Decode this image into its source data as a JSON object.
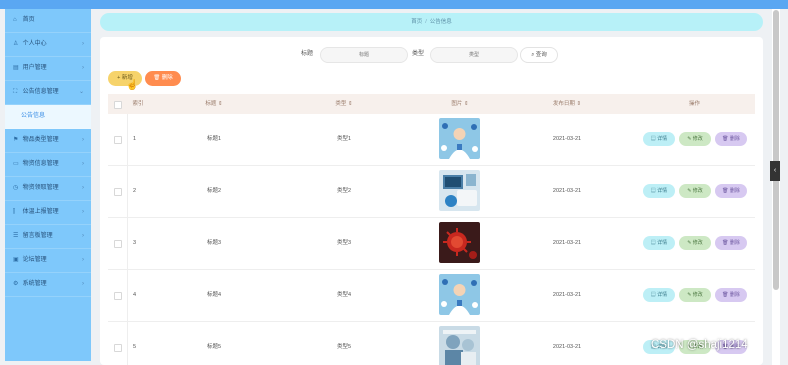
{
  "sidebar": {
    "items": [
      {
        "label": "首页",
        "icon": "home-icon",
        "glyph": "⌂",
        "arrow": ""
      },
      {
        "label": "个人中心",
        "icon": "user-icon",
        "glyph": "♙",
        "arrow": "›"
      },
      {
        "label": "用户管理",
        "icon": "users-icon",
        "glyph": "▤",
        "arrow": "›"
      },
      {
        "label": "公告信息管理",
        "icon": "notice-icon",
        "glyph": "⛶",
        "arrow": "⌄"
      },
      {
        "label": "公告信息",
        "icon": "",
        "glyph": "",
        "arrow": "",
        "sub": true
      },
      {
        "label": "物品类型管理",
        "icon": "category-icon",
        "glyph": "⚑",
        "arrow": "›"
      },
      {
        "label": "物资信息管理",
        "icon": "goods-icon",
        "glyph": "▭",
        "arrow": "›"
      },
      {
        "label": "物资领取管理",
        "icon": "receive-icon",
        "glyph": "◷",
        "arrow": "›"
      },
      {
        "label": "体温上报管理",
        "icon": "temperature-icon",
        "glyph": "⫿",
        "arrow": "›"
      },
      {
        "label": "留言板管理",
        "icon": "message-icon",
        "glyph": "☰",
        "arrow": "›"
      },
      {
        "label": "论坛管理",
        "icon": "forum-icon",
        "glyph": "▣",
        "arrow": "›"
      },
      {
        "label": "系统管理",
        "icon": "settings-icon",
        "glyph": "⚙",
        "arrow": "›"
      }
    ]
  },
  "breadcrumb": {
    "home": "首页",
    "separator": "/",
    "current": "公告信息"
  },
  "search": {
    "title_label": "标题",
    "title_placeholder": "标题",
    "type_label": "类型",
    "type_placeholder": "类型",
    "query_label": "⌕ 查询"
  },
  "toolbar": {
    "add_label": "+ 新增",
    "delete_label": "🗑 删除"
  },
  "table": {
    "headers": [
      "索引",
      "标题 ⇕",
      "类型 ⇕",
      "图片 ⇕",
      "发布日期 ⇕",
      "操作"
    ],
    "rows": [
      {
        "index": "1",
        "title": "标题1",
        "type": "类型1",
        "date": "2021-03-21",
        "image": "medical-staff-illustration"
      },
      {
        "index": "2",
        "title": "标题2",
        "type": "类型2",
        "date": "2021-03-21",
        "image": "medical-device-photo"
      },
      {
        "index": "3",
        "title": "标题3",
        "type": "类型3",
        "date": "2021-03-21",
        "image": "virus-photo"
      },
      {
        "index": "4",
        "title": "标题4",
        "type": "类型4",
        "date": "2021-03-21",
        "image": "medical-staff-illustration"
      },
      {
        "index": "5",
        "title": "标题5",
        "type": "类型5",
        "date": "2021-03-21",
        "image": "surgery-photo"
      }
    ],
    "actions": {
      "detail": "▤ 详情",
      "edit": "✎ 修改",
      "remove": "🗑 删除"
    }
  },
  "side_tab": "‹",
  "watermark": "CSDN @shaji1214",
  "colors": {
    "sidebar": "#7ec8fb",
    "breadcrumb": "#b7f1f8",
    "add": "#f6d36b",
    "delete": "#ff8c4f",
    "detail": "#bdeff6",
    "edit": "#cde8c4",
    "remove": "#d7c9f1"
  }
}
